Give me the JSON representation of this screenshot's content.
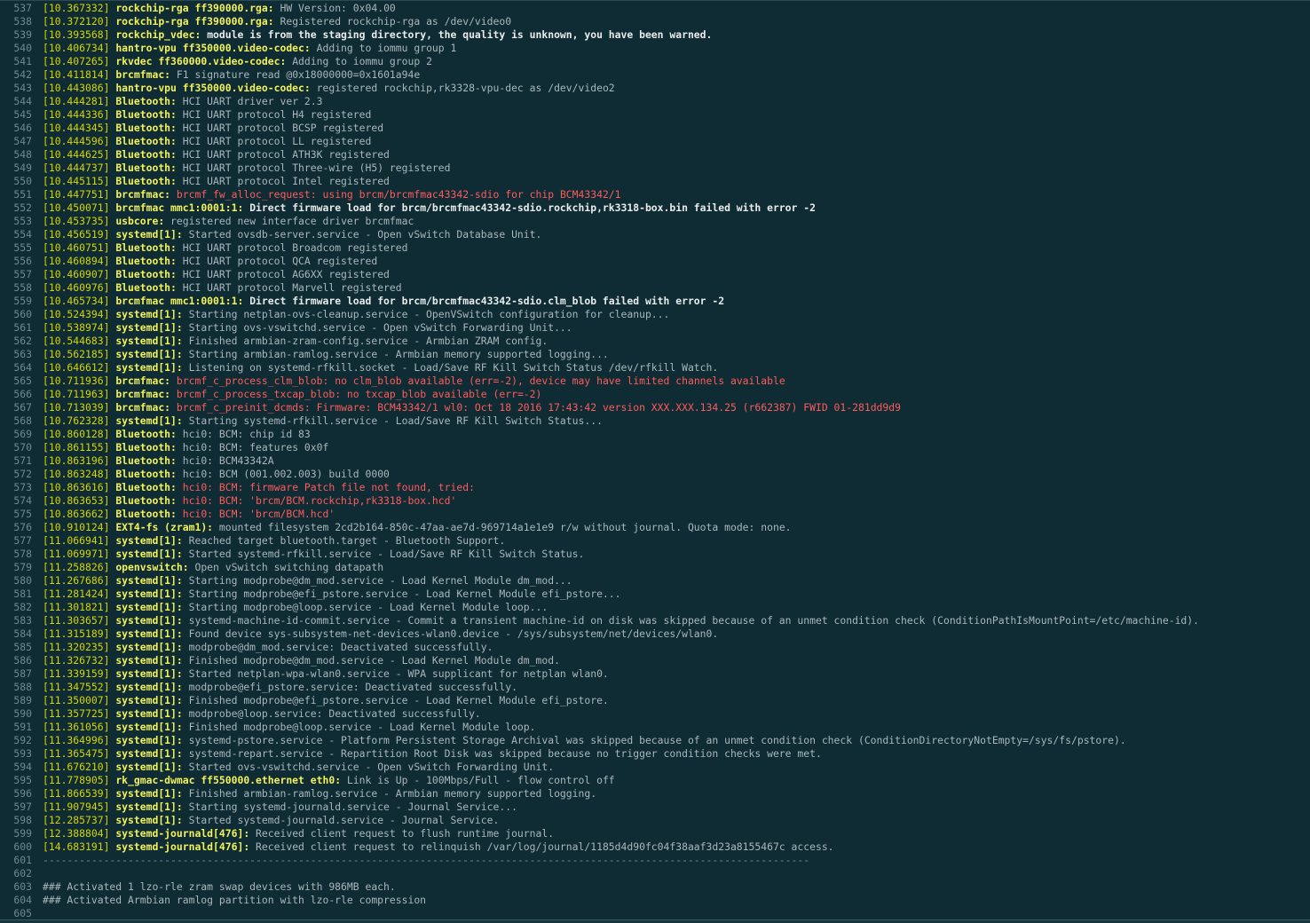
{
  "log": [
    {
      "n": "537",
      "ts": "10.367332",
      "src": "rockchip-rga ff390000.rga:",
      "msg": "HW Version: 0x04.00",
      "style": "normal"
    },
    {
      "n": "538",
      "ts": "10.372120",
      "src": "rockchip-rga ff390000.rga:",
      "msg": "Registered rockchip-rga as /dev/video0",
      "style": "normal"
    },
    {
      "n": "539",
      "ts": "10.393568",
      "src": "rockchip_vdec:",
      "msg": "module is from the staging directory, the quality is unknown, you have been warned.",
      "style": "bold"
    },
    {
      "n": "540",
      "ts": "10.406734",
      "src": "hantro-vpu ff350000.video-codec:",
      "msg": "Adding to iommu group 1",
      "style": "normal"
    },
    {
      "n": "541",
      "ts": "10.407265",
      "src": "rkvdec ff360000.video-codec:",
      "msg": "Adding to iommu group 2",
      "style": "normal"
    },
    {
      "n": "542",
      "ts": "10.411814",
      "src": "brcmfmac:",
      "msg": "F1 signature read @0x18000000=0x1601a94e",
      "style": "normal"
    },
    {
      "n": "543",
      "ts": "10.443086",
      "src": "hantro-vpu ff350000.video-codec:",
      "msg": "registered rockchip,rk3328-vpu-dec as /dev/video2",
      "style": "normal"
    },
    {
      "n": "544",
      "ts": "10.444281",
      "src": "Bluetooth:",
      "msg": "HCI UART driver ver 2.3",
      "style": "normal"
    },
    {
      "n": "545",
      "ts": "10.444336",
      "src": "Bluetooth:",
      "msg": "HCI UART protocol H4 registered",
      "style": "normal"
    },
    {
      "n": "546",
      "ts": "10.444345",
      "src": "Bluetooth:",
      "msg": "HCI UART protocol BCSP registered",
      "style": "normal"
    },
    {
      "n": "547",
      "ts": "10.444596",
      "src": "Bluetooth:",
      "msg": "HCI UART protocol LL registered",
      "style": "normal"
    },
    {
      "n": "548",
      "ts": "10.444625",
      "src": "Bluetooth:",
      "msg": "HCI UART protocol ATH3K registered",
      "style": "normal"
    },
    {
      "n": "549",
      "ts": "10.444737",
      "src": "Bluetooth:",
      "msg": "HCI UART protocol Three-wire (H5) registered",
      "style": "normal"
    },
    {
      "n": "550",
      "ts": "10.445115",
      "src": "Bluetooth:",
      "msg": "HCI UART protocol Intel registered",
      "style": "normal"
    },
    {
      "n": "551",
      "ts": "10.447751",
      "src": "brcmfmac:",
      "msg": "brcmf_fw_alloc_request: using brcm/brcmfmac43342-sdio for chip BCM43342/1",
      "style": "error"
    },
    {
      "n": "552",
      "ts": "10.450071",
      "src": "brcmfmac mmc1:0001:1:",
      "msg": "Direct firmware load for brcm/brcmfmac43342-sdio.rockchip,rk3318-box.bin failed with error -2",
      "style": "bold"
    },
    {
      "n": "553",
      "ts": "10.453735",
      "src": "usbcore:",
      "msg": "registered new interface driver brcmfmac",
      "style": "normal"
    },
    {
      "n": "554",
      "ts": "10.456519",
      "src": "systemd[1]:",
      "msg": "Started ovsdb-server.service - Open vSwitch Database Unit.",
      "style": "normal"
    },
    {
      "n": "555",
      "ts": "10.460751",
      "src": "Bluetooth:",
      "msg": "HCI UART protocol Broadcom registered",
      "style": "normal"
    },
    {
      "n": "556",
      "ts": "10.460894",
      "src": "Bluetooth:",
      "msg": "HCI UART protocol QCA registered",
      "style": "normal"
    },
    {
      "n": "557",
      "ts": "10.460907",
      "src": "Bluetooth:",
      "msg": "HCI UART protocol AG6XX registered",
      "style": "normal"
    },
    {
      "n": "558",
      "ts": "10.460976",
      "src": "Bluetooth:",
      "msg": "HCI UART protocol Marvell registered",
      "style": "normal"
    },
    {
      "n": "559",
      "ts": "10.465734",
      "src": "brcmfmac mmc1:0001:1:",
      "msg": "Direct firmware load for brcm/brcmfmac43342-sdio.clm_blob failed with error -2",
      "style": "bold"
    },
    {
      "n": "560",
      "ts": "10.524394",
      "src": "systemd[1]:",
      "msg": "Starting netplan-ovs-cleanup.service - OpenVSwitch configuration for cleanup...",
      "style": "normal"
    },
    {
      "n": "561",
      "ts": "10.538974",
      "src": "systemd[1]:",
      "msg": "Starting ovs-vswitchd.service - Open vSwitch Forwarding Unit...",
      "style": "normal"
    },
    {
      "n": "562",
      "ts": "10.544683",
      "src": "systemd[1]:",
      "msg": "Finished armbian-zram-config.service - Armbian ZRAM config.",
      "style": "normal"
    },
    {
      "n": "563",
      "ts": "10.562185",
      "src": "systemd[1]:",
      "msg": "Starting armbian-ramlog.service - Armbian memory supported logging...",
      "style": "normal"
    },
    {
      "n": "564",
      "ts": "10.646612",
      "src": "systemd[1]:",
      "msg": "Listening on systemd-rfkill.socket - Load/Save RF Kill Switch Status /dev/rfkill Watch.",
      "style": "normal"
    },
    {
      "n": "565",
      "ts": "10.711936",
      "src": "brcmfmac:",
      "msg": "brcmf_c_process_clm_blob: no clm_blob available (err=-2), device may have limited channels available",
      "style": "error"
    },
    {
      "n": "566",
      "ts": "10.711963",
      "src": "brcmfmac:",
      "msg": "brcmf_c_process_txcap_blob: no txcap_blob available (err=-2)",
      "style": "error"
    },
    {
      "n": "567",
      "ts": "10.713039",
      "src": "brcmfmac:",
      "msg": "brcmf_c_preinit_dcmds: Firmware: BCM43342/1 wl0: Oct 18 2016 17:43:42 version XXX.XXX.134.25 (r662387) FWID 01-281dd9d9",
      "style": "error"
    },
    {
      "n": "568",
      "ts": "10.762328",
      "src": "systemd[1]:",
      "msg": "Starting systemd-rfkill.service - Load/Save RF Kill Switch Status...",
      "style": "normal"
    },
    {
      "n": "569",
      "ts": "10.860128",
      "src": "Bluetooth:",
      "msg": "hci0: BCM: chip id 83",
      "style": "normal"
    },
    {
      "n": "570",
      "ts": "10.861155",
      "src": "Bluetooth:",
      "msg": "hci0: BCM: features 0x0f",
      "style": "normal"
    },
    {
      "n": "571",
      "ts": "10.863196",
      "src": "Bluetooth:",
      "msg": "hci0: BCM43342A",
      "style": "normal"
    },
    {
      "n": "572",
      "ts": "10.863248",
      "src": "Bluetooth:",
      "msg": "hci0: BCM (001.002.003) build 0000",
      "style": "normal"
    },
    {
      "n": "573",
      "ts": "10.863616",
      "src": "Bluetooth:",
      "msg": "hci0: BCM: firmware Patch file not found, tried:",
      "style": "error"
    },
    {
      "n": "574",
      "ts": "10.863653",
      "src": "Bluetooth:",
      "msg": "hci0: BCM: 'brcm/BCM.rockchip,rk3318-box.hcd'",
      "style": "error"
    },
    {
      "n": "575",
      "ts": "10.863662",
      "src": "Bluetooth:",
      "msg": "hci0: BCM: 'brcm/BCM.hcd'",
      "style": "error"
    },
    {
      "n": "576",
      "ts": "10.910124",
      "src": "EXT4-fs (zram1):",
      "msg": "mounted filesystem 2cd2b164-850c-47aa-ae7d-969714a1e1e9 r/w without journal. Quota mode: none.",
      "style": "normal"
    },
    {
      "n": "577",
      "ts": "11.066941",
      "src": "systemd[1]:",
      "msg": "Reached target bluetooth.target - Bluetooth Support.",
      "style": "normal"
    },
    {
      "n": "578",
      "ts": "11.069971",
      "src": "systemd[1]:",
      "msg": "Started systemd-rfkill.service - Load/Save RF Kill Switch Status.",
      "style": "normal"
    },
    {
      "n": "579",
      "ts": "11.258826",
      "src": "openvswitch:",
      "msg": "Open vSwitch switching datapath",
      "style": "normal"
    },
    {
      "n": "580",
      "ts": "11.267686",
      "src": "systemd[1]:",
      "msg": "Starting modprobe@dm_mod.service - Load Kernel Module dm_mod...",
      "style": "normal"
    },
    {
      "n": "581",
      "ts": "11.281424",
      "src": "systemd[1]:",
      "msg": "Starting modprobe@efi_pstore.service - Load Kernel Module efi_pstore...",
      "style": "normal"
    },
    {
      "n": "582",
      "ts": "11.301821",
      "src": "systemd[1]:",
      "msg": "Starting modprobe@loop.service - Load Kernel Module loop...",
      "style": "normal"
    },
    {
      "n": "583",
      "ts": "11.303657",
      "src": "systemd[1]:",
      "msg": "systemd-machine-id-commit.service - Commit a transient machine-id on disk was skipped because of an unmet condition check (ConditionPathIsMountPoint=/etc/machine-id).",
      "style": "normal"
    },
    {
      "n": "584",
      "ts": "11.315189",
      "src": "systemd[1]:",
      "msg": "Found device sys-subsystem-net-devices-wlan0.device - /sys/subsystem/net/devices/wlan0.",
      "style": "normal"
    },
    {
      "n": "585",
      "ts": "11.320235",
      "src": "systemd[1]:",
      "msg": "modprobe@dm_mod.service: Deactivated successfully.",
      "style": "normal"
    },
    {
      "n": "586",
      "ts": "11.326732",
      "src": "systemd[1]:",
      "msg": "Finished modprobe@dm_mod.service - Load Kernel Module dm_mod.",
      "style": "normal"
    },
    {
      "n": "587",
      "ts": "11.339159",
      "src": "systemd[1]:",
      "msg": "Started netplan-wpa-wlan0.service - WPA supplicant for netplan wlan0.",
      "style": "normal"
    },
    {
      "n": "588",
      "ts": "11.347552",
      "src": "systemd[1]:",
      "msg": "modprobe@efi_pstore.service: Deactivated successfully.",
      "style": "normal"
    },
    {
      "n": "589",
      "ts": "11.350007",
      "src": "systemd[1]:",
      "msg": "Finished modprobe@efi_pstore.service - Load Kernel Module efi_pstore.",
      "style": "normal"
    },
    {
      "n": "590",
      "ts": "11.357725",
      "src": "systemd[1]:",
      "msg": "modprobe@loop.service: Deactivated successfully.",
      "style": "normal"
    },
    {
      "n": "591",
      "ts": "11.361056",
      "src": "systemd[1]:",
      "msg": "Finished modprobe@loop.service - Load Kernel Module loop.",
      "style": "normal"
    },
    {
      "n": "592",
      "ts": "11.364996",
      "src": "systemd[1]:",
      "msg": "systemd-pstore.service - Platform Persistent Storage Archival was skipped because of an unmet condition check (ConditionDirectoryNotEmpty=/sys/fs/pstore).",
      "style": "normal"
    },
    {
      "n": "593",
      "ts": "11.365475",
      "src": "systemd[1]:",
      "msg": "systemd-repart.service - Repartition Root Disk was skipped because no trigger condition checks were met.",
      "style": "normal"
    },
    {
      "n": "594",
      "ts": "11.676210",
      "src": "systemd[1]:",
      "msg": "Started ovs-vswitchd.service - Open vSwitch Forwarding Unit.",
      "style": "normal"
    },
    {
      "n": "595",
      "ts": "11.778905",
      "src": "rk_gmac-dwmac ff550000.ethernet eth0:",
      "msg": "Link is Up - 100Mbps/Full - flow control off",
      "style": "normal"
    },
    {
      "n": "596",
      "ts": "11.866539",
      "src": "systemd[1]:",
      "msg": "Finished armbian-ramlog.service - Armbian memory supported logging.",
      "style": "normal"
    },
    {
      "n": "597",
      "ts": "11.907945",
      "src": "systemd[1]:",
      "msg": "Starting systemd-journald.service - Journal Service...",
      "style": "normal"
    },
    {
      "n": "598",
      "ts": "12.285737",
      "src": "systemd[1]:",
      "msg": "Started systemd-journald.service - Journal Service.",
      "style": "normal"
    },
    {
      "n": "599",
      "ts": "12.388804",
      "src": "systemd-journald[476]:",
      "msg": "Received client request to flush runtime journal.",
      "style": "normal"
    },
    {
      "n": "600",
      "ts": "14.683191",
      "src": "systemd-journald[476]:",
      "msg": "Received client request to relinquish /var/log/journal/1185d4d90fc04f38aaf3d23a8155467c access.",
      "style": "normal"
    }
  ],
  "tail": [
    {
      "n": "601",
      "text": "------------------------------------------------------------------------------------------------------------------------------",
      "kind": "sep"
    },
    {
      "n": "602",
      "text": "",
      "kind": "plain"
    },
    {
      "n": "603",
      "text": "### Activated 1 lzo-rle zram swap devices with 986MB each.",
      "kind": "plain"
    },
    {
      "n": "604",
      "text": "### Activated Armbian ramlog partition with lzo-rle compression",
      "kind": "plain"
    },
    {
      "n": "605",
      "text": "",
      "kind": "plain"
    }
  ],
  "colors": {
    "background": "#0f2b33",
    "line_number": "#6e8a91",
    "timestamp": "#d6d600",
    "source": "#f2f25a",
    "message": "#a9b8bc",
    "error": "#ff5c5c"
  }
}
